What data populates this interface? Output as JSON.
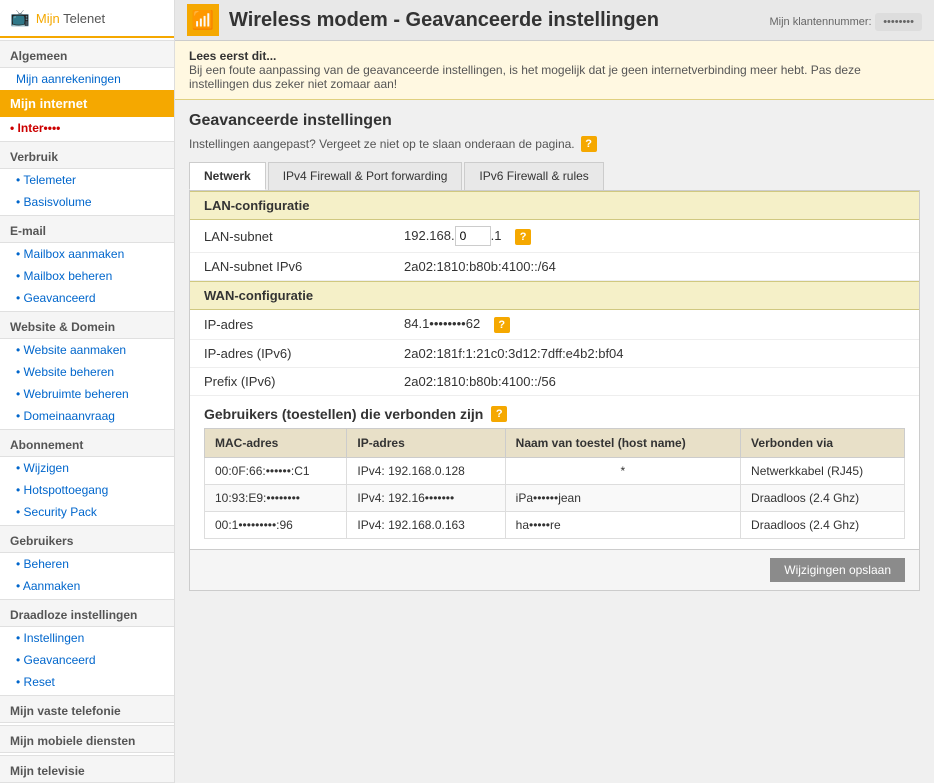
{
  "header": {
    "logo": "Mijn Telenet",
    "logo_mijn": "Mijn ",
    "logo_telenet": "Telenet",
    "page_title": "Wireless modem - Geavanceerde instellingen",
    "klant_label": "Mijn klantennummer:",
    "klant_value": "••••••••"
  },
  "warning": {
    "title": "Lees eerst dit...",
    "text": "Bij een foute aanpassing van de geavanceerde instellingen, is het mogelijk dat je geen internetverbinding meer hebt. Pas deze instellingen dus zeker niet zomaar aan!"
  },
  "advanced": {
    "title": "Geavanceerde instellingen",
    "note": "Instellingen aangepast? Vergeet ze niet op te slaan onderaan de pagina."
  },
  "tabs": [
    {
      "label": "Netwerk",
      "active": true
    },
    {
      "label": "IPv4 Firewall & Port forwarding",
      "active": false
    },
    {
      "label": "IPv6 Firewall & rules",
      "active": false
    }
  ],
  "lan_section": {
    "title": "LAN-configuratie",
    "rows": [
      {
        "label": "LAN-subnet",
        "value": "192.168.",
        "input_value": "0",
        "suffix": ".1",
        "has_help": true
      },
      {
        "label": "LAN-subnet IPv6",
        "value": "2a02:1810:b80b:4100::/64",
        "has_help": false
      }
    ]
  },
  "wan_section": {
    "title": "WAN-configuratie",
    "rows": [
      {
        "label": "IP-adres",
        "value": "84.1••••••••62",
        "has_help": true
      },
      {
        "label": "IP-adres (IPv6)",
        "value": "2a02:181f:1:21c0:3d12:7dff:e4b2:bf04",
        "has_help": false
      },
      {
        "label": "Prefix (IPv6)",
        "value": "2a02:1810:b80b:4100::/56",
        "has_help": false
      }
    ]
  },
  "users_section": {
    "title": "Gebruikers (toestellen) die verbonden zijn",
    "has_help": true,
    "columns": [
      "MAC-adres",
      "IP-adres",
      "Naam van toestel (host name)",
      "Verbonden via"
    ],
    "rows": [
      {
        "mac": "00:0F:66:••••••:C1",
        "ip": "IPv4: 192.168.0.128",
        "name": "*",
        "connected": "Netwerkkabel (RJ45)"
      },
      {
        "mac": "10:93:E9:••••••••",
        "ip": "IPv4: 192.16•••••••",
        "name": "iPa••••••jean",
        "connected": "Draadloos (2.4 Ghz)"
      },
      {
        "mac": "00:1•••••••••:96",
        "ip": "IPv4: 192.168.0.163",
        "name": "ha•••••re",
        "connected": "Draadloos (2.4 Ghz)"
      }
    ]
  },
  "save_button": "Wijzigingen opslaan",
  "sidebar": {
    "logo": "Mijn Telenet",
    "sections": [
      {
        "type": "section",
        "label": "Algemeen"
      },
      {
        "type": "active-section",
        "label": "Mijn aanrekeningen"
      },
      {
        "type": "active-highlight",
        "label": "Mijn internet"
      },
      {
        "type": "parent",
        "label": "• Inter••••"
      },
      {
        "type": "subsection",
        "label": "Verbruik"
      },
      {
        "type": "subitem",
        "label": "• Telemeter"
      },
      {
        "type": "subitem",
        "label": "• Basisvolume"
      },
      {
        "type": "subsection",
        "label": "E-mail"
      },
      {
        "type": "subitem",
        "label": "• Mailbox aanmaken"
      },
      {
        "type": "subitem",
        "label": "• Mailbox beheren"
      },
      {
        "type": "subitem",
        "label": "• Geavanceerd"
      },
      {
        "type": "subsection",
        "label": "Website & Domein"
      },
      {
        "type": "subitem",
        "label": "• Website aanmaken"
      },
      {
        "type": "subitem",
        "label": "• Website beheren"
      },
      {
        "type": "subitem",
        "label": "• Webruimte beheren"
      },
      {
        "type": "subitem",
        "label": "• Domeinaanvraag"
      },
      {
        "type": "subsection",
        "label": "Abonnement"
      },
      {
        "type": "subitem",
        "label": "• Wijzigen"
      },
      {
        "type": "subitem",
        "label": "• Hotspottoegang"
      },
      {
        "type": "subitem",
        "label": "• Security Pack"
      },
      {
        "type": "subsection",
        "label": "Gebruikers"
      },
      {
        "type": "subitem",
        "label": "• Beheren"
      },
      {
        "type": "subitem",
        "label": "• Aanmaken"
      },
      {
        "type": "subsection",
        "label": "Draadloze instellingen"
      },
      {
        "type": "subitem",
        "label": "• Instellingen"
      },
      {
        "type": "subitem",
        "label": "• Geavanceerd"
      },
      {
        "type": "subitem",
        "label": "• Reset"
      },
      {
        "type": "section",
        "label": "Mijn vaste telefonie"
      },
      {
        "type": "section",
        "label": "Mijn mobiele diensten"
      },
      {
        "type": "section",
        "label": "Mijn televisie"
      }
    ]
  }
}
